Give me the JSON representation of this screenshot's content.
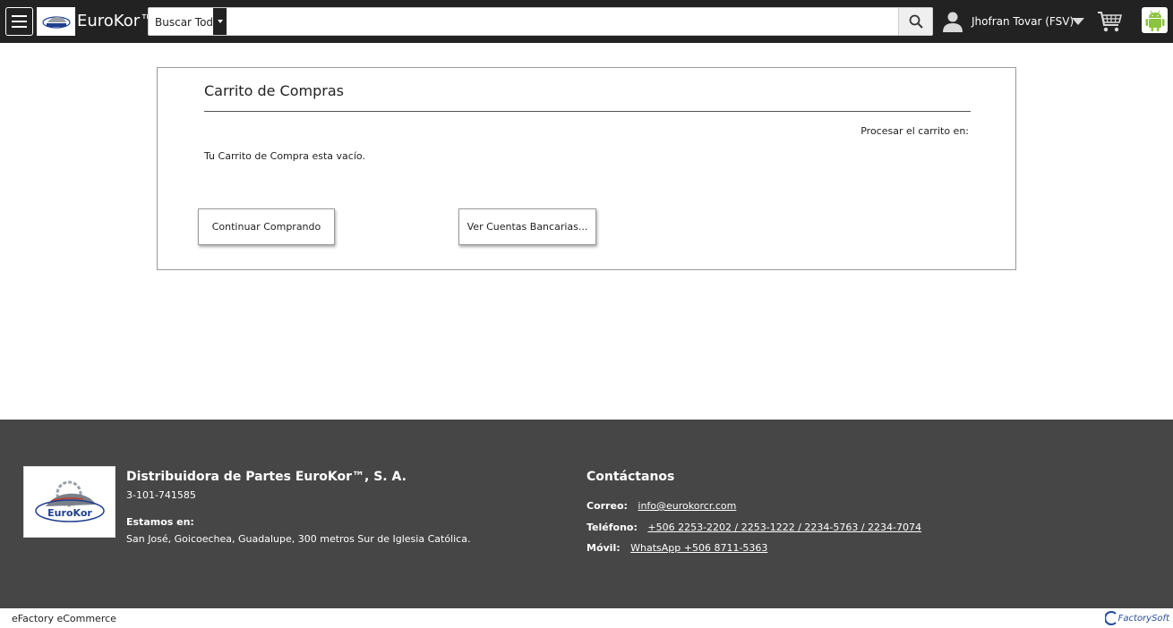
{
  "header": {
    "brand": "EuroKor™",
    "search_category": "Buscar Todo",
    "search_placeholder": "",
    "user_name": "Jhofran Tovar (FSV)"
  },
  "cart": {
    "title": "Carrito de Compras",
    "process_label": "Procesar el carrito en:",
    "empty_message": "Tu Carrito de Compra esta vacío.",
    "continue_button": "Continuar Comprando",
    "bank_button": "Ver Cuentas Bancarias..."
  },
  "footer": {
    "company_name": "Distribuidora de Partes EuroKor™, S. A.",
    "company_id": "3-101-741585",
    "location_label": "Estamos en:",
    "address": "San José, Goicoechea, Guadalupe, 300 metros Sur de Iglesia Católica.",
    "contact_title": "Contáctanos",
    "email_label": "Correo:",
    "email": "info@eurokorcr.com",
    "phone_label": "Teléfono:",
    "phones": "+506 2253-2202 / 2253-1222 / 2234-5763 / 2234-7074",
    "mobile_label": "Móvil:",
    "mobile": "WhatsApp +506 8711-5363",
    "logo_text": "EuroKor"
  },
  "bottom": {
    "platform": "eFactory eCommerce",
    "powered_by": "FactorySoft"
  },
  "colors": {
    "header_bg": "#222222",
    "footer_bg": "#464646",
    "android_green": "#8cc43f"
  },
  "icons": {
    "menu": "hamburger-icon",
    "search": "search-icon",
    "user": "user-icon",
    "dropdown": "caret-down-icon",
    "cart": "shopping-cart-icon",
    "android": "android-icon"
  }
}
